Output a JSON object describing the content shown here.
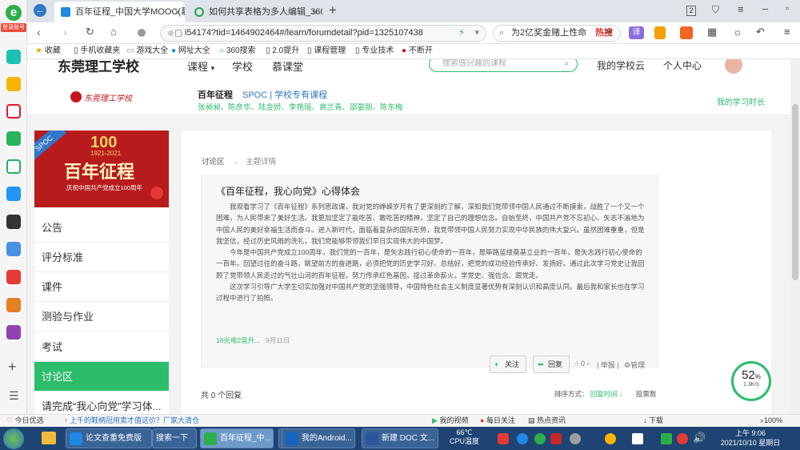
{
  "colors": {
    "accent": "#2cbd6b",
    "link_blue": "#2f77c9",
    "brand_red": "#c8161d",
    "taskbar": "#1d4472"
  },
  "left_sidebar": {
    "login_badge": "登录账号"
  },
  "browser": {
    "tabs": [
      {
        "title": "百年征程_中国大学MOOC(慕课)"
      },
      {
        "title": "如何共享表格为多人编辑_360搜"
      }
    ],
    "tab_counter": "2",
    "url": "i54174?tid=1464902464#/learn/forumdetail?pid=1325107438",
    "search_text": "为2亿奖金赌上性命",
    "search_tag": "热搜",
    "translate_label": "译",
    "bookmarks": [
      "收藏",
      "手机收藏夹",
      "游戏大全",
      "网址大全",
      "360搜索",
      "2.0提升",
      "课程管理",
      "专业技术",
      "不断开"
    ]
  },
  "site": {
    "school_name": "东莞理工学校",
    "nav": [
      "课程",
      "学校",
      "慕课堂"
    ],
    "search_placeholder": "搜索感兴趣的课程",
    "my_school_cloud": "我的学校云",
    "personal_center": "个人中心"
  },
  "course": {
    "logo_text": "东莞理工学校",
    "title": "百年征程",
    "spoc_label": "SPOC | 学校专有课程",
    "teachers": "张昶昶、陈彦华、陆金娇、李艳瑶、高兰青、邵晏朋、陈东梅",
    "learning_time": "我的学习时长"
  },
  "banner": {
    "spoc_tag": "SPOC",
    "years": "1921-2021",
    "big_title": "百年征程",
    "subtitle": "庆祝中国共产党成立100周年"
  },
  "menu": [
    {
      "label": "公告"
    },
    {
      "label": "评分标准"
    },
    {
      "label": "课件"
    },
    {
      "label": "测验与作业"
    },
    {
      "label": "考试"
    },
    {
      "label": "讨论区"
    },
    {
      "label": "请完成“我心向党”学习体..."
    }
  ],
  "breadcrumb": {
    "root": "讨论区",
    "sep": "→",
    "current": "主题详情"
  },
  "post": {
    "title": "《百年征程，我心向党》心得体会",
    "paragraphs": [
      "我观看学习了《百年征程》系列思政课，我对党的峥嵘岁月有了更深刻的了解，深知我们党带领中国人民通过不断摸索，战胜了一个又一个困难，为人民带来了美好生活。我更加坚定了能吃苦、敢吃苦的精神，坚定了自己的理想信念。自始至终，中国共产党不忘初心、矢志不渝地为中国人民的美好幸福生活而奋斗。进入新时代，面临着复杂的国际形势，我党带领中国人民努力实现中华民族的伟大复兴。虽然困难重重，但是我坚信，经过历史风雨的洗礼，我们党能够带领我们早日实现伟大的中国梦。",
      "今年是中国共产党成立100周年，我们党的一百年，是矢志践行初心使命的一百年，是筚路蓝缕奠基立业的一百年，是矢志践行初心使命的一百年。回望过往的奋斗路，眺望前方的奋进路，必须把党的历史学习好、总结好，把党的成功经验传承好、发扬好。通过此次学习党史让我回顾了党带领人民走过的气壮山河的百年征程，努力传承红色基因，接过革命薪火，学党史、强信念、跟党走。",
      "这次学习引导广大学生切实加强对中国共产党的坚强领导，中国特色社会主义制度显著优势有深刻认识和高度认同。最后我和家长也在学习过程中进行了拍照。"
    ],
    "author": "18光电2吴升...",
    "date": "9月11日",
    "follow_label": "关注",
    "reply_label": "回复",
    "like_count": "0",
    "report_label": "举报",
    "manage_label": "管理"
  },
  "replies": {
    "count_text": "共 0 个回复",
    "sort_label": "排序方式：",
    "sort_by_time": "回复时间",
    "sort_by_votes": "投票数"
  },
  "speed_widget": {
    "percent": "52",
    "unit": "%",
    "speed": "1.3K/s"
  },
  "statusbar": {
    "left1": "今日优选",
    "left2": "上千的鞋柄冠用卖才值这价？厂家大清仓",
    "items": [
      "我的视频",
      "每日关注",
      "热点资讯",
      "下载",
      "100%"
    ]
  },
  "taskbar": {
    "buttons": [
      {
        "label": "论文查重免费版"
      },
      {
        "label": "搜索一下"
      },
      {
        "label": "百年征程_中..."
      },
      {
        "label": ""
      },
      {
        "label": "我的Android..."
      },
      {
        "label": "新建 DOC 文..."
      }
    ],
    "temp": "66℃",
    "temp_label": "CPU温度",
    "clock_time": "上午 9:06",
    "clock_date": "2021/10/10 星期日"
  }
}
